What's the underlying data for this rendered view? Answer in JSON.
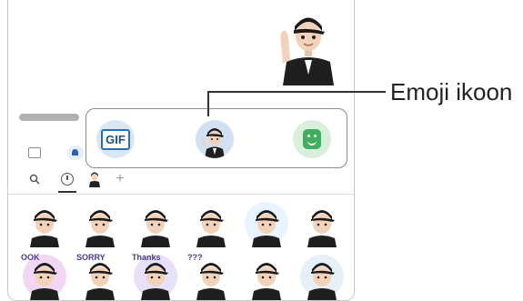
{
  "popup": {
    "gif_label": "GIF"
  },
  "callout": {
    "label": "Emoji ikoon"
  },
  "icons": {
    "search": "search-icon",
    "recent": "clock-icon",
    "avatar": "avatar-icon",
    "add": "plus-icon",
    "sticker": "sticker-icon",
    "emoji": "ar-emoji-icon",
    "gif": "gif-icon"
  },
  "colors": {
    "gif_bg": "#dbe7f0",
    "emoji_bg": "#d2e0f3",
    "sticker_bg": "#d9efdc",
    "sticker_green": "#3fae5f"
  },
  "stickers": [
    {
      "caption": ""
    },
    {
      "caption": ""
    },
    {
      "caption": ""
    },
    {
      "caption": ""
    },
    {
      "caption": ""
    },
    {
      "caption": ""
    },
    {
      "caption": "OOK"
    },
    {
      "caption": "SORRY"
    },
    {
      "caption": "Thanks"
    },
    {
      "caption": "???"
    },
    {
      "caption": ""
    },
    {
      "caption": ""
    }
  ]
}
